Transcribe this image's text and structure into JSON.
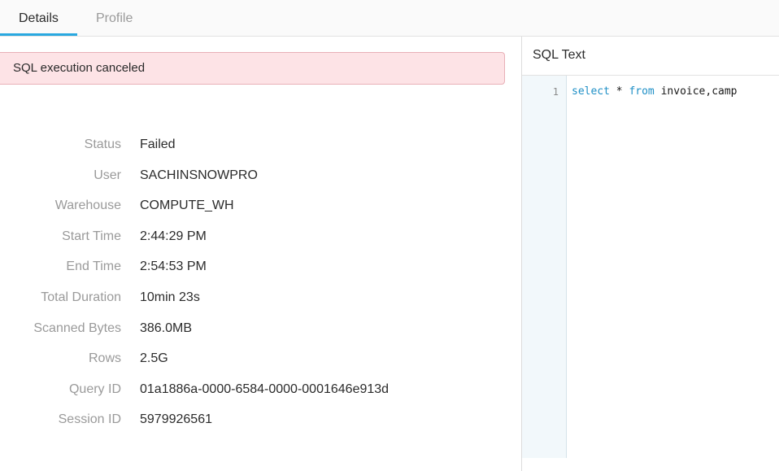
{
  "tabs": {
    "details": "Details",
    "profile": "Profile"
  },
  "alert": {
    "message": "SQL execution canceled"
  },
  "details": {
    "rows": [
      {
        "label": "Status",
        "value": "Failed"
      },
      {
        "label": "User",
        "value": "SACHINSNOWPRO"
      },
      {
        "label": "Warehouse",
        "value": "COMPUTE_WH"
      },
      {
        "label": "Start Time",
        "value": "2:44:29 PM"
      },
      {
        "label": "End Time",
        "value": "2:54:53 PM"
      },
      {
        "label": "Total Duration",
        "value": "10min 23s"
      },
      {
        "label": "Scanned Bytes",
        "value": "386.0MB"
      },
      {
        "label": "Rows",
        "value": "2.5G"
      },
      {
        "label": "Query ID",
        "value": "01a1886a-0000-6584-0000-0001646e913d"
      },
      {
        "label": "Session ID",
        "value": "5979926561"
      }
    ]
  },
  "sql": {
    "title": "SQL Text",
    "line_number": "1",
    "tokens": {
      "kw_select": "select",
      "star": "*",
      "kw_from": "from",
      "tables": "invoice,camp"
    }
  },
  "colors": {
    "accent": "#29a8e0",
    "alert_bg": "#fde3e6",
    "alert_border": "#e8b0b7",
    "keyword": "#1e8fc6"
  }
}
